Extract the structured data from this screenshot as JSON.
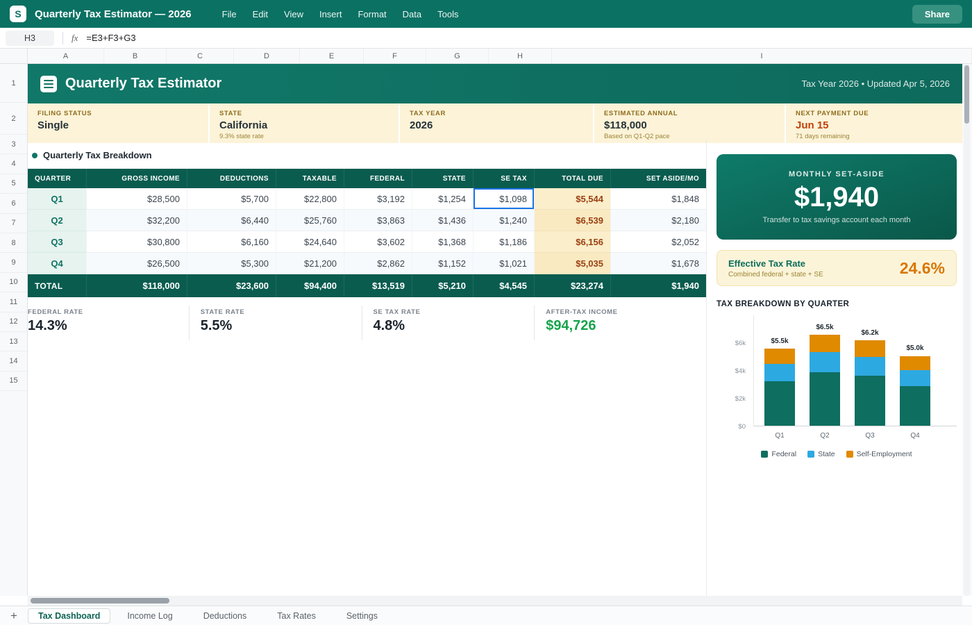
{
  "colors": {
    "brand_teal": "#0b7163",
    "table_header_teal": "#0a5c4f",
    "accent_orange": "#d97706",
    "accent_green": "#16a34a",
    "alert_red": "#c2410c",
    "selection_blue": "#1a73e8",
    "card_cream": "#fcf3d8"
  },
  "app": {
    "logo_letter": "S",
    "title": "Quarterly Tax Estimator — 2026",
    "menus": [
      "File",
      "Edit",
      "View",
      "Insert",
      "Format",
      "Data",
      "Tools"
    ],
    "share_label": "Share"
  },
  "formula_bar": {
    "cell_ref": "H3",
    "fx_label": "fx",
    "formula": "=E3+F3+G3"
  },
  "grid": {
    "column_letters": [
      "A",
      "B",
      "C",
      "D",
      "E",
      "F",
      "G",
      "H",
      "I"
    ],
    "row_numbers": [
      "1",
      "2",
      "3",
      "4",
      "5",
      "6",
      "7",
      "8",
      "9",
      "10",
      "11",
      "12",
      "13",
      "14",
      "15"
    ]
  },
  "banner": {
    "title": "Quarterly Tax Estimator",
    "meta": "Tax Year 2026 • Updated Apr 5, 2026"
  },
  "info_cards": [
    {
      "label": "FILING STATUS",
      "value": "Single",
      "note": "",
      "highlight": false
    },
    {
      "label": "STATE",
      "value": "California",
      "note": "9.3% state rate",
      "highlight": false
    },
    {
      "label": "TAX YEAR",
      "value": "2026",
      "note": "",
      "highlight": false
    },
    {
      "label": "ESTIMATED ANNUAL",
      "value": "$118,000",
      "note": "Based on Q1-Q2 pace",
      "highlight": false
    },
    {
      "label": "NEXT PAYMENT DUE",
      "value": "Jun 15",
      "note": "71 days remaining",
      "highlight": true
    }
  ],
  "section_title": "Quarterly Tax Breakdown",
  "table": {
    "headers": [
      "QUARTER",
      "GROSS INCOME",
      "DEDUCTIONS",
      "TAXABLE",
      "FEDERAL",
      "STATE",
      "SE TAX",
      "TOTAL DUE",
      "SET ASIDE/MO"
    ],
    "rows": [
      [
        "Q1",
        "$28,500",
        "$5,700",
        "$22,800",
        "$3,192",
        "$1,254",
        "$1,098",
        "$5,544",
        "$1,848"
      ],
      [
        "Q2",
        "$32,200",
        "$6,440",
        "$25,760",
        "$3,863",
        "$1,436",
        "$1,240",
        "$6,539",
        "$2,180"
      ],
      [
        "Q3",
        "$30,800",
        "$6,160",
        "$24,640",
        "$3,602",
        "$1,368",
        "$1,186",
        "$6,156",
        "$2,052"
      ],
      [
        "Q4",
        "$26,500",
        "$5,300",
        "$21,200",
        "$2,862",
        "$1,152",
        "$1,021",
        "$5,035",
        "$1,678"
      ]
    ],
    "total_row": [
      "TOTAL",
      "$118,000",
      "$23,600",
      "$94,400",
      "$13,519",
      "$5,210",
      "$4,545",
      "$23,274",
      "$1,940"
    ],
    "selected_cell": {
      "ref": "H3",
      "row": 0,
      "col": 6
    }
  },
  "stats": [
    {
      "label": "FEDERAL RATE",
      "value": "14.3%",
      "green": false
    },
    {
      "label": "STATE RATE",
      "value": "5.5%",
      "green": false
    },
    {
      "label": "SE TAX RATE",
      "value": "4.8%",
      "green": false
    },
    {
      "label": "AFTER-TAX INCOME",
      "value": "$94,726",
      "green": true
    }
  ],
  "sidebar": {
    "setaside": {
      "label": "MONTHLY SET-ASIDE",
      "value": "$1,940",
      "note": "Transfer to tax savings account each month"
    },
    "rate_card": {
      "title": "Effective Tax Rate",
      "subtitle": "Combined federal + state + SE",
      "value": "24.6%"
    },
    "chart_title": "TAX BREAKDOWN BY QUARTER"
  },
  "chart_data": {
    "type": "bar",
    "stacked": true,
    "title": "TAX BREAKDOWN BY QUARTER",
    "categories": [
      "Q1",
      "Q2",
      "Q3",
      "Q4"
    ],
    "series": [
      {
        "name": "Federal",
        "color": "#0e6e5f",
        "values": [
          3192,
          3863,
          3602,
          2862
        ]
      },
      {
        "name": "State",
        "color": "#2da9e1",
        "values": [
          1254,
          1436,
          1368,
          1152
        ]
      },
      {
        "name": "Self-Employment",
        "color": "#e08a00",
        "values": [
          1098,
          1240,
          1186,
          1021
        ]
      }
    ],
    "bar_total_labels": [
      "$5.5k",
      "$6.5k",
      "$6.2k",
      "$5.0k"
    ],
    "y_ticks": [
      {
        "v": 0,
        "label": "$0"
      },
      {
        "v": 2000,
        "label": "$2k"
      },
      {
        "v": 4000,
        "label": "$4k"
      },
      {
        "v": 6000,
        "label": "$6k"
      }
    ],
    "ylim": [
      0,
      8000
    ],
    "legend_position": "bottom"
  },
  "sheet_bar": {
    "add_label": "+",
    "tabs": [
      {
        "label": "Tax Dashboard",
        "active": true
      },
      {
        "label": "Income Log",
        "active": false
      },
      {
        "label": "Deductions",
        "active": false
      },
      {
        "label": "Tax Rates",
        "active": false
      },
      {
        "label": "Settings",
        "active": false
      }
    ]
  }
}
